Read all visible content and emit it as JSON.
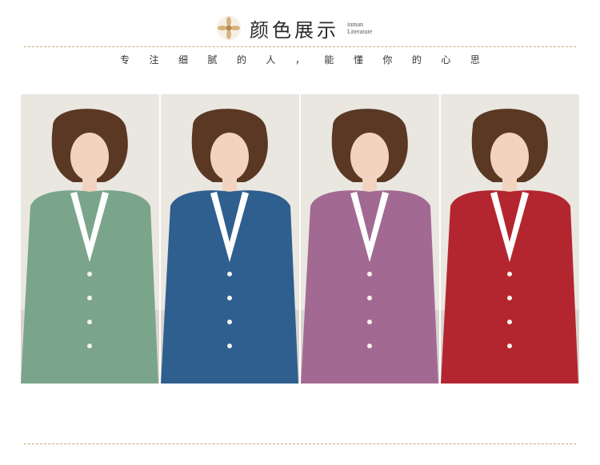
{
  "header": {
    "title": "颜色展示",
    "subtitle_line1": "inman",
    "subtitle_line2": "Literature",
    "tagline": [
      "专",
      "注",
      "细",
      "腻",
      "的",
      "人",
      "，",
      "能",
      "懂",
      "你",
      "的",
      "心",
      "思"
    ]
  },
  "icons": {
    "logo": "flower-icon"
  },
  "colors": {
    "divider": "#c6a97a",
    "variants": [
      "#7aa58b",
      "#2e5f8e",
      "#a26a92",
      "#b3262f"
    ]
  }
}
